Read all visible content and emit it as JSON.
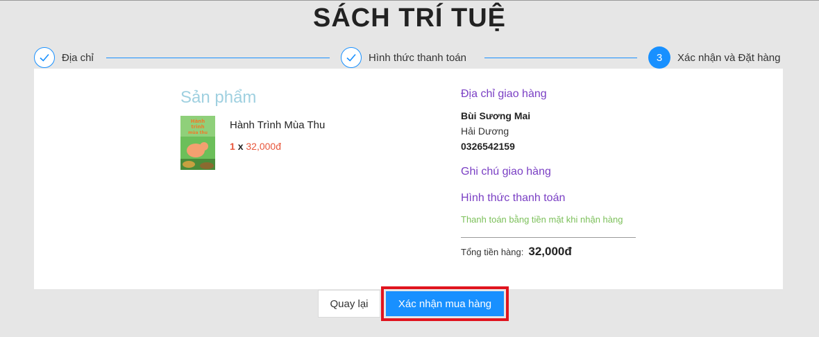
{
  "header": {
    "title": "SÁCH TRÍ TUỆ"
  },
  "steps": [
    {
      "label": "Địa chỉ",
      "state": "done",
      "icon": "check-icon"
    },
    {
      "label": "Hình thức thanh toán",
      "state": "done",
      "icon": "check-icon"
    },
    {
      "label": "Xác nhận và Đặt hàng",
      "state": "active",
      "number": "3"
    }
  ],
  "products": {
    "heading": "Sản phẩm",
    "items": [
      {
        "name": "Hành Trình Mùa Thu",
        "qty": "1",
        "times": "x",
        "price": "32,000đ",
        "cover_text": "Hành trình mùa thu"
      }
    ]
  },
  "shipping": {
    "heading": "Địa chỉ giao hàng",
    "name": "Bùi Sương Mai",
    "city": "Hải Dương",
    "phone": "0326542159"
  },
  "note": {
    "heading": "Ghi chú giao hàng"
  },
  "payment": {
    "heading": "Hình thức thanh toán",
    "method": "Thanh toán bằng tiền mặt khi nhận hàng"
  },
  "total": {
    "label": "Tổng tiền hàng:",
    "value": "32,000đ"
  },
  "actions": {
    "back_label": "Quay lại",
    "confirm_label": "Xác nhận mua hàng"
  },
  "colors": {
    "accent": "#1890ff",
    "section_heading": "#7a3fc4",
    "price": "#e8553a",
    "payment_method": "#7cc05a",
    "highlight_border": "#e0141e"
  }
}
